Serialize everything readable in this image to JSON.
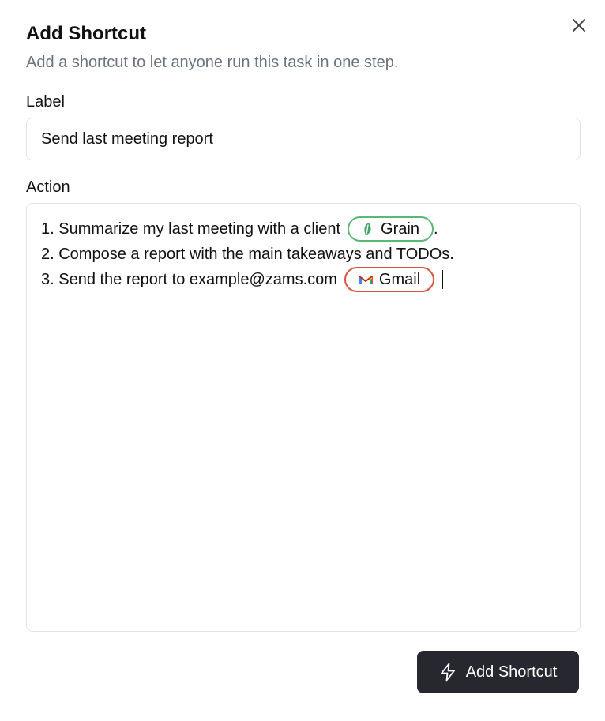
{
  "dialog": {
    "title": "Add Shortcut",
    "subtitle": "Add a shortcut to let anyone run this task in one step.",
    "close_icon": "close-icon"
  },
  "label_field": {
    "label": "Label",
    "value": "Send last meeting report"
  },
  "action_field": {
    "label": "Action",
    "lines": [
      {
        "text": "1. Summarize my last meeting with a client",
        "chip": {
          "label": "Grain",
          "icon": "grain-leaf-icon",
          "color": "#5bb874"
        },
        "suffix": "."
      },
      {
        "text": "2. Compose a report with the main takeaways and TODOs."
      },
      {
        "text": "3. Send the report to example@zams.com",
        "chip": {
          "label": "Gmail",
          "icon": "gmail-icon",
          "color": "#d6553f"
        }
      }
    ]
  },
  "submit": {
    "label": "Add Shortcut",
    "icon": "lightning-bolt-icon"
  },
  "colors": {
    "primary_button": "#26272f",
    "muted_text": "#6b7280",
    "border": "#e2e4e8"
  }
}
